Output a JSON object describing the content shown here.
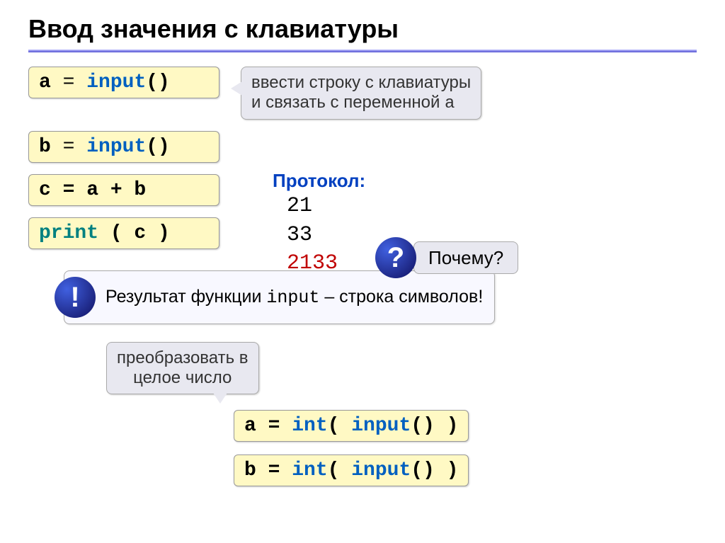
{
  "title": "Ввод значения с клавиатуры",
  "code": {
    "line1_a": "a",
    "line1_eq": " = ",
    "line1_fn": "input",
    "line1_par": "()",
    "line2_b": "b",
    "line2_eq": " = ",
    "line2_fn": "input",
    "line2_par": "()",
    "line3": "c = a + b",
    "line4_fn": "print",
    "line4_arg": " ( c )",
    "int_a_pre": "a = ",
    "int_a_fn1": "int",
    "int_a_mid": "( ",
    "int_a_fn2": "input",
    "int_a_post": "() )",
    "int_b_pre": "b = ",
    "int_b_fn1": "int",
    "int_b_mid": "( ",
    "int_b_fn2": "input",
    "int_b_post": "() )"
  },
  "callouts": {
    "top_line1": "ввести строку с клавиатуры",
    "top_line2_a": "и связать с переменной ",
    "top_line2_b": "a",
    "convert_line1": "преобразовать в",
    "convert_line2": "целое число",
    "why": "Почему?",
    "result_pre": "Результат функции ",
    "result_fn": "input",
    "result_post": " – строка символов!"
  },
  "protocol": {
    "label": "Протокол:",
    "v1": "21",
    "v2": "33",
    "v3": "2133"
  },
  "badges": {
    "question": "?",
    "exclaim": "!"
  }
}
